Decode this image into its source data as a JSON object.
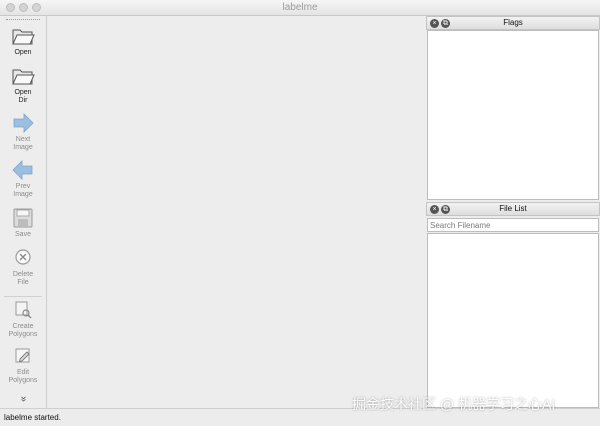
{
  "window": {
    "title": "labelme"
  },
  "toolbar": {
    "open": "Open",
    "open_dir": "Open\nDir",
    "next_image": "Next\nImage",
    "prev_image": "Prev\nImage",
    "save": "Save",
    "delete_file": "Delete\nFile",
    "create_polygons": "Create\nPolygons",
    "edit_polygons": "Edit\nPolygons",
    "expand_glyph": "»"
  },
  "flags_panel": {
    "title": "Flags"
  },
  "file_list_panel": {
    "title": "File List",
    "search_placeholder": "Search Filename",
    "search_value": ""
  },
  "status": {
    "text": "labelme started."
  },
  "watermark": {
    "text": "掘金技术社区 @ 机器学习之心AI"
  },
  "colors": {
    "accent_arrow": "#6fa4d4",
    "disabled_arrow": "#b5cfe6"
  }
}
